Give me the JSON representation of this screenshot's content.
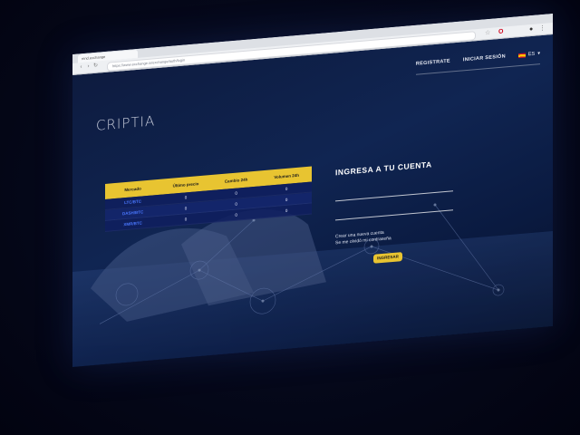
{
  "browser": {
    "tab_title": "mnd.exchange",
    "url": "https://www.exchange.io/exchange/auth/login"
  },
  "site": {
    "logo": "CRIPTIA",
    "nav": {
      "register": "REGISTRATE",
      "login": "INICIAR SESIÓN",
      "language": "ES"
    }
  },
  "market_table": {
    "headers": [
      "Mercado",
      "Último precio",
      "Cambio 24h",
      "Volumen 24h"
    ],
    "rows": [
      {
        "pair": "LTC/BTC",
        "price": "0",
        "change": "0",
        "volume": "0"
      },
      {
        "pair": "DASH/BTC",
        "price": "0",
        "change": "0",
        "volume": "0"
      },
      {
        "pair": "XMR/BTC",
        "price": "0",
        "change": "0",
        "volume": "0"
      }
    ]
  },
  "login": {
    "title": "INGRESA A TU CUENTA",
    "create_account": "Crear una nueva cuenta",
    "forgot_password": "Se me olvidó mi contraseña",
    "submit": "INGRESAR"
  },
  "colors": {
    "accent": "#e8c431",
    "background": "#102552",
    "link_blue": "#4a78ff"
  }
}
